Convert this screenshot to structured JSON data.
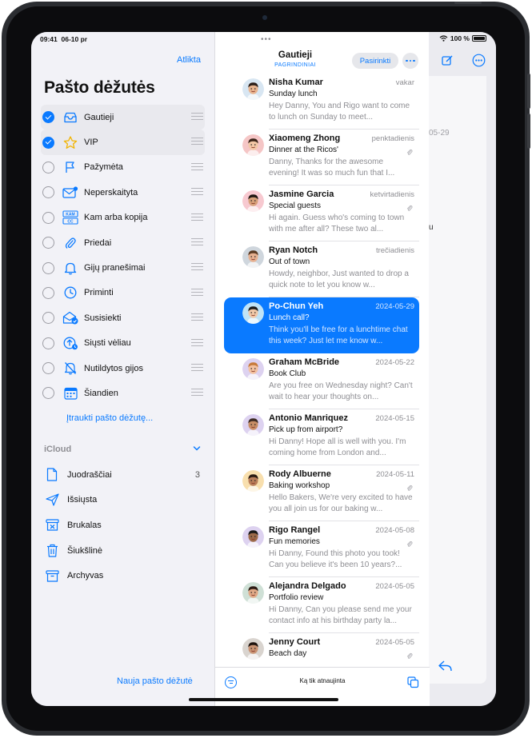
{
  "status": {
    "time": "09:41",
    "date": "06-10 pr",
    "battery": "100 %"
  },
  "sidebar": {
    "done_label": "Atlikta",
    "title": "Pašto dėžutės",
    "mailboxes": [
      {
        "label": "Gautieji",
        "checked": true,
        "icon": "inbox-icon"
      },
      {
        "label": "VIP",
        "checked": true,
        "icon": "star-icon"
      },
      {
        "label": "Pažymėta",
        "checked": false,
        "icon": "flag-icon"
      },
      {
        "label": "Neperskaityta",
        "checked": false,
        "icon": "unread-envelope-icon"
      },
      {
        "label": "Kam arba kopija",
        "checked": false,
        "icon": "to-cc-icon"
      },
      {
        "label": "Priedai",
        "checked": false,
        "icon": "paperclip-icon"
      },
      {
        "label": "Gijų pranešimai",
        "checked": false,
        "icon": "bell-icon"
      },
      {
        "label": "Priminti",
        "checked": false,
        "icon": "clock-icon"
      },
      {
        "label": "Susisiekti",
        "checked": false,
        "icon": "follow-up-envelope-icon"
      },
      {
        "label": "Siųsti vėliau",
        "checked": false,
        "icon": "send-later-icon"
      },
      {
        "label": "Nutildytos gijos",
        "checked": false,
        "icon": "muted-bell-icon"
      },
      {
        "label": "Šiandien",
        "checked": false,
        "icon": "calendar-icon"
      }
    ],
    "add_mailbox_label": "Įtraukti pašto dėžutę...",
    "icloud_header": "iCloud",
    "icloud_items": [
      {
        "label": "Juodraščiai",
        "count": "3",
        "icon": "drafts-icon"
      },
      {
        "label": "Išsiųsta",
        "count": "",
        "icon": "sent-icon"
      },
      {
        "label": "Brukalas",
        "count": "",
        "icon": "junk-icon"
      },
      {
        "label": "Šiukšlinė",
        "count": "",
        "icon": "trash-icon"
      },
      {
        "label": "Archyvas",
        "count": "",
        "icon": "archive-icon"
      }
    ],
    "new_mailbox_label": "Nauja pašto dėžutė"
  },
  "list": {
    "title": "Gautieji",
    "subtitle": "PAGRINDINIAI",
    "select_label": "Pasirinkti",
    "updated_label": "Ką tik atnaujinta",
    "messages": [
      {
        "sender": "Nisha Kumar",
        "date": "vakar",
        "subject": "Sunday lunch",
        "preview": "Hey Danny, You and Rigo want to come to lunch on Sunday to meet...",
        "attachment": false,
        "selected": false,
        "avatar_color": "#d8e6f2"
      },
      {
        "sender": "Xiaomeng Zhong",
        "date": "penktadienis",
        "subject": "Dinner at the Ricos'",
        "preview": "Danny, Thanks for the awesome evening! It was so much fun that I...",
        "attachment": true,
        "selected": false,
        "avatar_color": "#f5c6c6"
      },
      {
        "sender": "Jasmine Garcia",
        "date": "ketvirtadienis",
        "subject": "Special guests",
        "preview": "Hi again. Guess who's coming to town with me after all? These two al...",
        "attachment": true,
        "selected": false,
        "avatar_color": "#f7c9d0"
      },
      {
        "sender": "Ryan Notch",
        "date": "trečiadienis",
        "subject": "Out of town",
        "preview": "Howdy, neighbor, Just wanted to drop a quick note to let you know w...",
        "attachment": false,
        "selected": false,
        "avatar_color": "#cfd6dd"
      },
      {
        "sender": "Po-Chun Yeh",
        "date": "2024-05-29",
        "subject": "Lunch call?",
        "preview": "Think you'll be free for a lunchtime chat this week? Just let me know w...",
        "attachment": false,
        "selected": true,
        "avatar_color": "#bfe3f7"
      },
      {
        "sender": "Graham McBride",
        "date": "2024-05-22",
        "subject": "Book Club",
        "preview": "Are you free on Wednesday night? Can't wait to hear your thoughts on...",
        "attachment": false,
        "selected": false,
        "avatar_color": "#ddd2f0"
      },
      {
        "sender": "Antonio Manriquez",
        "date": "2024-05-15",
        "subject": "Pick up from airport?",
        "preview": "Hi Danny! Hope all is well with you. I'm coming home from London and...",
        "attachment": false,
        "selected": false,
        "avatar_color": "#ddd2f0"
      },
      {
        "sender": "Rody Albuerne",
        "date": "2024-05-11",
        "subject": "Baking workshop",
        "preview": "Hello Bakers, We're very excited to have you all join us for our baking w...",
        "attachment": true,
        "selected": false,
        "avatar_color": "#f8dfae"
      },
      {
        "sender": "Rigo Rangel",
        "date": "2024-05-08",
        "subject": "Fun memories",
        "preview": "Hi Danny, Found this photo you took! Can you believe it's been 10 years?...",
        "attachment": true,
        "selected": false,
        "avatar_color": "#ddd2f0"
      },
      {
        "sender": "Alejandra Delgado",
        "date": "2024-05-05",
        "subject": "Portfolio review",
        "preview": "Hi Danny, Can you please send me your contact info at his birthday party la...",
        "attachment": false,
        "selected": false,
        "avatar_color": "#cfe0d6"
      },
      {
        "sender": "Jenny Court",
        "date": "2024-05-05",
        "subject": "Beach day",
        "preview": "",
        "attachment": true,
        "selected": false,
        "avatar_color": "#d9d4cf"
      }
    ]
  },
  "content": {
    "date_fragment": "05-29",
    "text_fragment": "u"
  },
  "colors": {
    "accent": "#0a7aff",
    "selected_row": "#0a7aff"
  }
}
